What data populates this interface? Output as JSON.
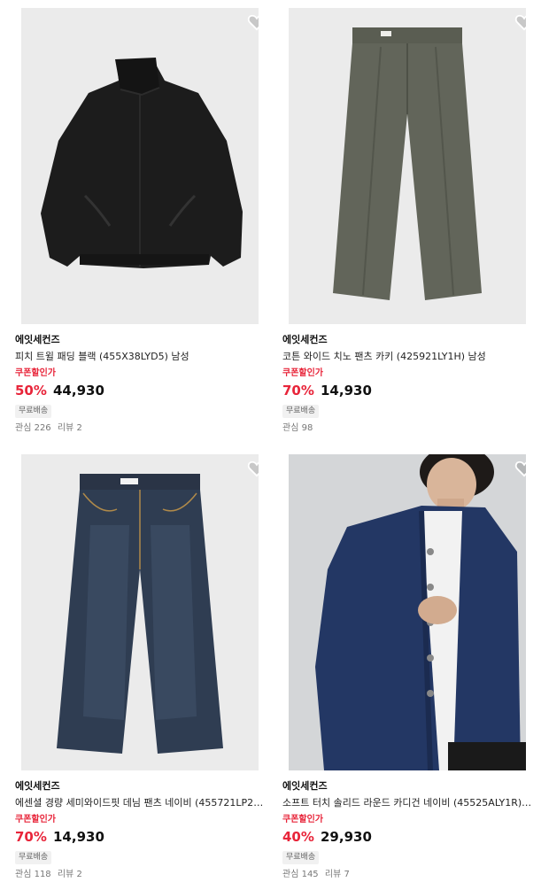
{
  "products": [
    {
      "brand": "에잇세컨즈",
      "name": "피치 트윌 패딩 블랙 (455X38LYD5) 남성",
      "coupon_label": "쿠폰할인가",
      "discount_rate": "50%",
      "price": "44,930",
      "shipping_badge": "무료배송",
      "likes": "관심 226",
      "reviews": "리뷰 2",
      "wishlisted": false,
      "image": "black-padded-jacket"
    },
    {
      "brand": "에잇세컨즈",
      "name": "코튼 와이드 치노 팬츠 카키 (425921LY1H) 남성",
      "coupon_label": "쿠폰할인가",
      "discount_rate": "70%",
      "price": "14,930",
      "shipping_badge": "무료배송",
      "likes": "관심 98",
      "reviews": "",
      "wishlisted": false,
      "image": "khaki-chino-pants"
    },
    {
      "brand": "에잇세컨즈",
      "name": "에센셜 경량 세미와이드핏 데님 팬츠 네이비 (455721LP2R...",
      "coupon_label": "쿠폰할인가",
      "discount_rate": "70%",
      "price": "14,930",
      "shipping_badge": "무료배송",
      "likes": "관심 118",
      "reviews": "리뷰 2",
      "wishlisted": false,
      "image": "denim-jeans"
    },
    {
      "brand": "에잇세컨즈",
      "name": "소프트 터치 솔리드 라운드 카디건 네이비 (45525ALY1R) ...",
      "coupon_label": "쿠폰할인가",
      "discount_rate": "40%",
      "price": "29,930",
      "shipping_badge": "무료배송",
      "likes": "관심 145",
      "reviews": "리뷰 7",
      "wishlisted": false,
      "image": "navy-cardigan-model"
    }
  ],
  "colors": {
    "accent_red": "#e8253a",
    "text_dark": "#111111",
    "muted": "#777777",
    "thumb_bg": "#ebebeb"
  }
}
